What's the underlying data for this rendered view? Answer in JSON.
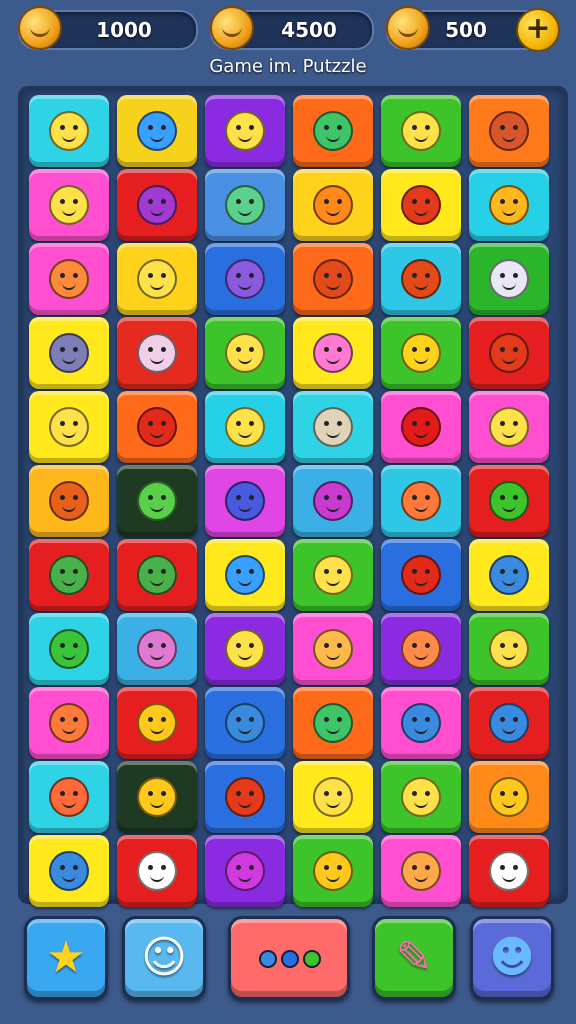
{
  "currencies": [
    {
      "value": "1000",
      "icon": "fruit-coin-icon",
      "color": "#f0a21a"
    },
    {
      "value": "4500",
      "icon": "gold-coin-icon",
      "color": "#f0b21a"
    },
    {
      "value": "500",
      "icon": "bronze-coin-icon",
      "color": "#e0911a"
    }
  ],
  "plus_label": "+",
  "title": "Game im. Putzzle",
  "grid": {
    "rows": 11,
    "cols": 6,
    "tiles": [
      [
        "#2ed3e6",
        "#f7d21c",
        "#8a2be2",
        "#ff6a1a",
        "#3cc42a",
        "#ff7a1a"
      ],
      [
        "#ff4fd0",
        "#e51f1f",
        "#4a90e2",
        "#ffd21c",
        "#ffe81c",
        "#26d0e6"
      ],
      [
        "#ff4fd0",
        "#ffd21c",
        "#2a6fe0",
        "#ff6a1a",
        "#2ec7e6",
        "#2bb52a"
      ],
      [
        "#ffe81c",
        "#e52a1f",
        "#3cc42a",
        "#ffe81c",
        "#3cc42a",
        "#e51f1f"
      ],
      [
        "#ffe81c",
        "#ff6a1a",
        "#26d0e6",
        "#2ed3e6",
        "#ff4fd0",
        "#ff4fd0"
      ],
      [
        "#ffb81c",
        "#1e3a22",
        "#e046e6",
        "#3ab0e6",
        "#2ec7e6",
        "#e51f1f"
      ],
      [
        "#e51f1f",
        "#e51f1f",
        "#ffe81c",
        "#3cc42a",
        "#2a6fe0",
        "#ffe81c"
      ],
      [
        "#2ed3e6",
        "#3ab0e6",
        "#8a2be2",
        "#ff4fd0",
        "#8a2be2",
        "#3cc42a"
      ],
      [
        "#ff4fd0",
        "#e51f1f",
        "#2a6fe0",
        "#ff6a1a",
        "#ff4fd0",
        "#e51f1f"
      ],
      [
        "#2ed3e6",
        "#1e3a22",
        "#2a6fe0",
        "#ffe81c",
        "#3cc42a",
        "#ff8a1a"
      ],
      [
        "#ffe81c",
        "#e51f1f",
        "#8a2be2",
        "#3cc42a",
        "#ff4fd0",
        "#e51f1f"
      ]
    ],
    "faces": [
      [
        "#ffe24a",
        "#3aa0ff",
        "#ffe24a",
        "#3fc46a",
        "#ffe24a",
        "#d9552a"
      ],
      [
        "#ffe24a",
        "#a03ad0",
        "#5ad08a",
        "#ff8a1a",
        "#e23a1a",
        "#ffb81c"
      ],
      [
        "#ff8a3a",
        "#ffe24a",
        "#8a5ae0",
        "#e24a1a",
        "#e24a1a",
        "#e8e8f5"
      ],
      [
        "#7d7db8",
        "#f0d0e6",
        "#ffe24a",
        "#ff7ad0",
        "#ffd21c",
        "#e23a1a"
      ],
      [
        "#ffe24a",
        "#e22a1a",
        "#ffe24a",
        "#e0d4b8",
        "#e21a1a",
        "#ffe24a"
      ],
      [
        "#e8601a",
        "#5ad04a",
        "#4a5ae0",
        "#c83ad0",
        "#ff7a3a",
        "#3cc42a"
      ],
      [
        "#4ab04a",
        "#4ab04a",
        "#3aa0ff",
        "#ffe24a",
        "#e22a1a",
        "#3a8ae0"
      ],
      [
        "#3ac43a",
        "#e07ad0",
        "#ffe24a",
        "#ffb84a",
        "#ff8a4a",
        "#ffe24a"
      ],
      [
        "#ff7a3a",
        "#ffc81c",
        "#3a8ae0",
        "#3fc46a",
        "#3a8ae0",
        "#3a8ae0"
      ],
      [
        "#ff6a3a",
        "#ffc81c",
        "#e23a1a",
        "#ffe24a",
        "#ffe24a",
        "#ffc81c"
      ],
      [
        "#3a8ae0",
        "#ffffff",
        "#d03ae0",
        "#ffc81c",
        "#ffa84a",
        "#ffffff"
      ]
    ]
  },
  "bottom_bar": [
    {
      "name": "star-booster",
      "icon": "star-icon",
      "glyph": "★",
      "color": "#3aa8f0"
    },
    {
      "name": "ghost-booster",
      "icon": "ghost-icon",
      "glyph": "☺",
      "color": "#5ab8f0"
    },
    {
      "name": "menu",
      "icon": "more-dots-icon",
      "glyph": "",
      "color": "#ff6a6a"
    },
    {
      "name": "hammer-booster",
      "icon": "hammer-icon",
      "glyph": "✎",
      "color": "#3cc42a"
    },
    {
      "name": "monster-booster",
      "icon": "monster-icon",
      "glyph": "☻",
      "color": "#5a6ad8"
    }
  ],
  "menu_dot_colors": [
    "#3a8ae0",
    "#2a6fe0",
    "#3cc42a"
  ]
}
